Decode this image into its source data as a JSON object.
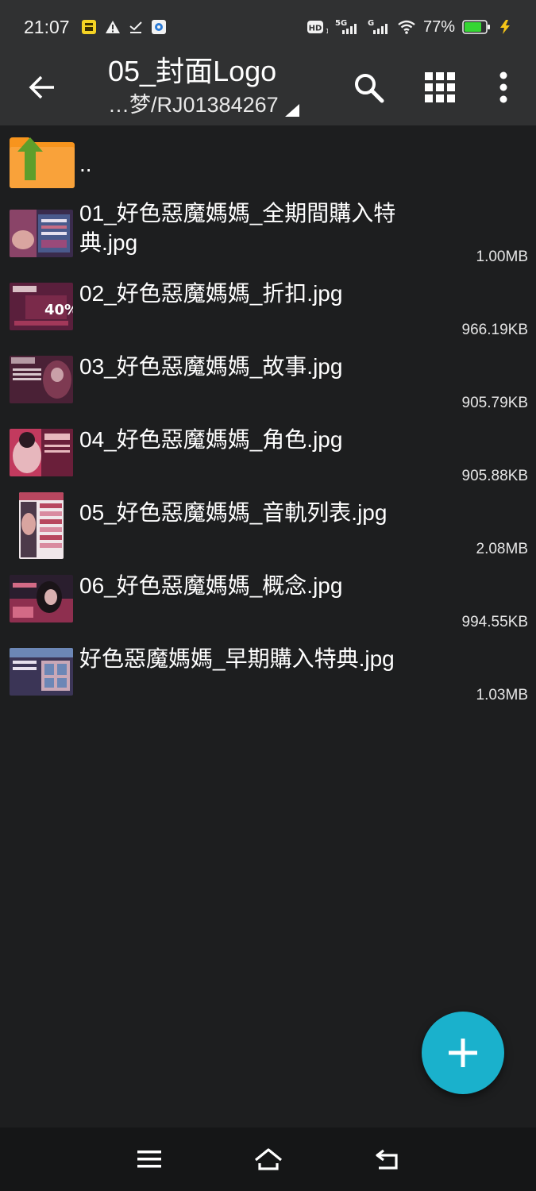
{
  "status_bar": {
    "time": "21:07",
    "battery_percent": "77%",
    "network_5g": "5G",
    "network_g": "G",
    "hd_label": "HD",
    "icons": [
      "notification-app-icon",
      "warning-icon",
      "download-done-icon",
      "app-icon",
      "hd-volte-icon",
      "signal-5g-icon",
      "signal-g-icon",
      "wifi-icon",
      "battery-icon",
      "charging-icon"
    ]
  },
  "app_bar": {
    "title": "05_封面Logo",
    "subtitle": "…梦/RJ01384267"
  },
  "files": [
    {
      "name": "..",
      "size": "",
      "icon": "parent-folder-icon"
    },
    {
      "name": "01_好色惡魔媽媽_全期間購入特典.jpg",
      "size": "1.00MB",
      "thumb_colors": [
        "#3a2b4c",
        "#9a4a7a",
        "#c66b84"
      ]
    },
    {
      "name": "02_好色惡魔媽媽_折扣.jpg",
      "size": "966.19KB",
      "thumb_colors": [
        "#5a1f3c",
        "#a3385a",
        "#d9bfc5"
      ]
    },
    {
      "name": "03_好色惡魔媽媽_故事.jpg",
      "size": "905.79KB",
      "thumb_colors": [
        "#4a2136",
        "#7e3a52",
        "#b59aa4"
      ]
    },
    {
      "name": "04_好色惡魔媽媽_角色.jpg",
      "size": "905.88KB",
      "thumb_colors": [
        "#6a1f3a",
        "#c23a5e",
        "#e7b7bd"
      ]
    },
    {
      "name": "05_好色惡魔媽媽_音軌列表.jpg",
      "size": "2.08MB",
      "thumb_colors": [
        "#f0e7ea",
        "#b8475f",
        "#4c3a4a"
      ]
    },
    {
      "name": "06_好色惡魔媽媽_概念.jpg",
      "size": "994.55KB",
      "thumb_colors": [
        "#2a1e2e",
        "#8e2f4f",
        "#d36a86"
      ]
    },
    {
      "name": "好色惡魔媽媽_早期購入特典.jpg",
      "size": "1.03MB",
      "thumb_colors": [
        "#3b3556",
        "#6c87b6",
        "#c9a8b7"
      ]
    }
  ],
  "colors": {
    "background": "#1d1e1f",
    "bar": "#303132",
    "fab": "#1ab1cc",
    "folder_orange": "#f7941d",
    "arrow_green": "#5e9e2b"
  }
}
